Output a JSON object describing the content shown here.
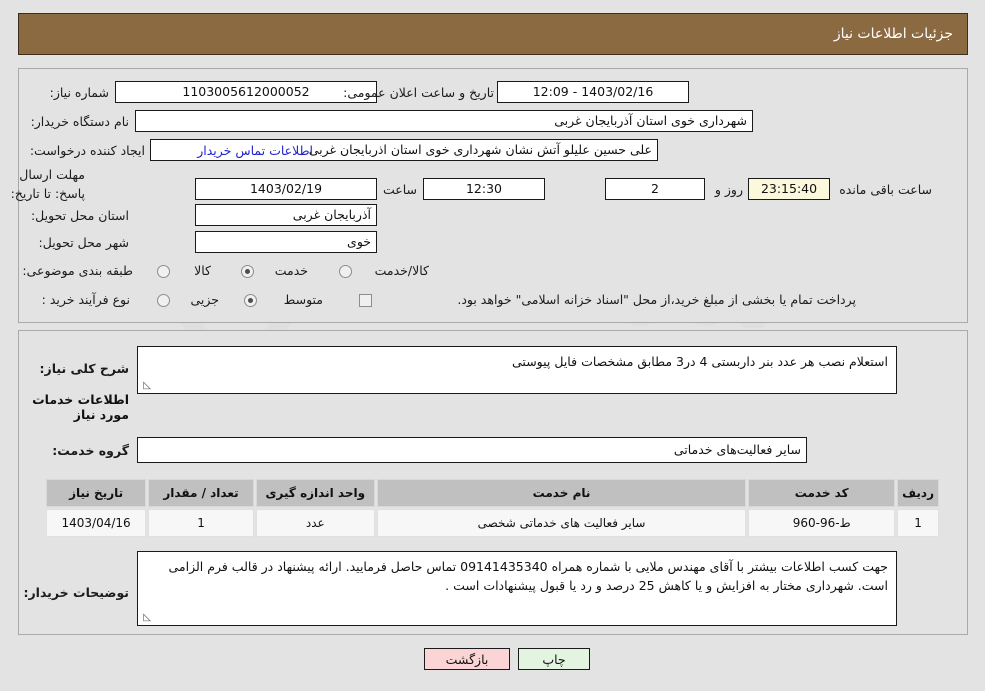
{
  "header": {
    "title": "جزئیات اطلاعات نیاز"
  },
  "form": {
    "need_number_label": "شماره نیاز:",
    "need_number_value": "1103005612000052",
    "announce_label": "تاریخ و ساعت اعلان عمومی:",
    "announce_value": "1403/02/16 - 12:09",
    "buyer_org_label": "نام دستگاه خریدار:",
    "buyer_org_value": "شهرداری خوی استان اذربایجان غربی",
    "buyer_org_value_left": "شهرداری خوی استان آذربایجان غربی",
    "requester_label": "ایجاد کننده درخواست:",
    "requester_value": "علی حسین علیلو آتش نشان شهرداری خوی استان اذربایجان غربی",
    "contact_link": "اطلاعات تماس خریدار",
    "deadline_label": "مهلت ارسال پاسخ: تا تاریخ:",
    "deadline_date": "1403/02/19",
    "hour_label": "ساعت",
    "deadline_time": "12:30",
    "days_value": "2",
    "days_label": "روز و",
    "countdown_value": "23:15:40",
    "countdown_label": "ساعت باقی مانده",
    "province_label": "استان محل تحویل:",
    "province_value": "آذربایجان غربی",
    "city_label": "شهر محل تحویل:",
    "city_value": "خوی",
    "category_label": "طبقه بندی موضوعی:",
    "category_options": [
      "کالا",
      "خدمت",
      "کالا/خدمت"
    ],
    "category_selected": "خدمت",
    "process_label": "نوع فرآیند خرید :",
    "process_options": [
      "جزیی",
      "متوسط"
    ],
    "process_selected": "متوسط",
    "treasury_note": "پرداخت تمام یا بخشی از مبلغ خرید،از محل \"اسناد خزانه اسلامی\" خواهد بود.",
    "treasury_checked": false
  },
  "need_description": {
    "label": "شرح کلی نیاز:",
    "value": "استعلام نصب هر عدد بنر داربستی 4 در3 مطابق مشخصات فایل پیوستی"
  },
  "services_section": {
    "title": "اطلاعات خدمات مورد نیاز",
    "group_label": "گروه خدمت:",
    "group_value": "سایر فعالیت‌های خدماتی"
  },
  "table": {
    "headers": [
      "ردیف",
      "کد خدمت",
      "نام خدمت",
      "واحد اندازه گیری",
      "تعداد / مقدار",
      "تاریخ نیاز"
    ],
    "rows": [
      {
        "row": "1",
        "code": "ط-96-960",
        "name": "سایر فعالیت های خدماتی شخصی",
        "unit": "عدد",
        "qty": "1",
        "date": "1403/04/16"
      }
    ]
  },
  "buyer_notes": {
    "label": "توضیحات خریدار:",
    "value": "جهت کسب اطلاعات بیشتر با آقای مهندس ملایی با شماره همراه 09141435340 تماس حاصل فرمایید. ارائه پیشنهاد در قالب فرم الزامی است. شهرداری مختار به افزایش و یا کاهش 25 درصد و رد یا قبول پیشنهادات است ."
  },
  "footer": {
    "back_label": "بازگشت",
    "print_label": "چاپ"
  },
  "colors": {
    "header_bg": "#8b6a42",
    "page_bg": "#e3e3e3",
    "link": "#2222cc",
    "countdown_bg": "#fbf8dc",
    "back_btn_bg": "#fbd5d5",
    "print_btn_bg": "#e3f5e1"
  }
}
